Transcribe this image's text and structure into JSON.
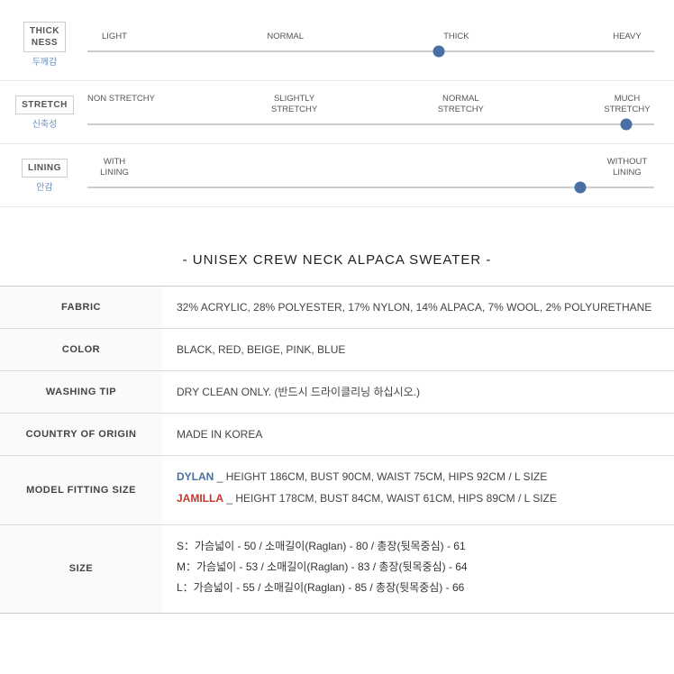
{
  "sliders": [
    {
      "id": "thickness",
      "eng": "THICK\nNESS",
      "kor": "두께감",
      "markers": [
        "LIGHT",
        "NORMAL",
        "THICK",
        "HEAVY"
      ],
      "dot_position_percent": 62
    },
    {
      "id": "stretch",
      "eng": "STRETCH",
      "kor": "신축성",
      "markers": [
        "NON STRETCHY",
        "SLIGHTLY\nSTRETCHY",
        "NORMAL\nSTRETCHY",
        "MUCH\nSTRETCHY"
      ],
      "dot_position_percent": 95
    },
    {
      "id": "lining",
      "eng": "LINING",
      "kor": "안감",
      "markers": [
        "WITH\nLINING",
        "",
        "",
        "WITHOUT\nLINING"
      ],
      "dot_position_percent": 87
    }
  ],
  "product_title": "- UNISEX CREW NECK ALPACA SWEATER -",
  "table": {
    "rows": [
      {
        "label": "FABRIC",
        "value": "32% ACRYLIC, 28% POLYESTER, 17% NYLON, 14% ALPACA, 7% WOOL, 2% POLYURETHANE"
      },
      {
        "label": "COLOR",
        "value": "BLACK, RED, BEIGE, PINK, BLUE"
      },
      {
        "label": "WASHING TIP",
        "value": "DRY CLEAN ONLY. (반드시 드라이클리닝 하십시오.)"
      },
      {
        "label": "COUNTRY OF ORIGIN",
        "value": "MADE IN KOREA"
      },
      {
        "label": "MODEL FITTING SIZE",
        "value_models": [
          {
            "name": "DYLAN",
            "name_type": "dylan",
            "detail": "_ HEIGHT 186CM, BUST 90CM, WAIST 75CM, HIPS 92CM / L SIZE"
          },
          {
            "name": "JAMILLA",
            "name_type": "jamilla",
            "detail": "_ HEIGHT 178CM, BUST 84CM, WAIST 61CM, HIPS 89CM / L SIZE"
          }
        ]
      },
      {
        "label": "SIZE",
        "value_sizes": [
          "S：가슴넓이 - 50 / 소매길이(Raglan) - 80 / 총장(뒷목중심) - 61",
          "M：가슴넓이 - 53 / 소매길이(Raglan) - 83 / 총장(뒷목중심) - 64",
          "L：가슴넓이 - 55 / 소매길이(Raglan) - 85 / 총장(뒷목중심) - 66"
        ]
      }
    ]
  }
}
